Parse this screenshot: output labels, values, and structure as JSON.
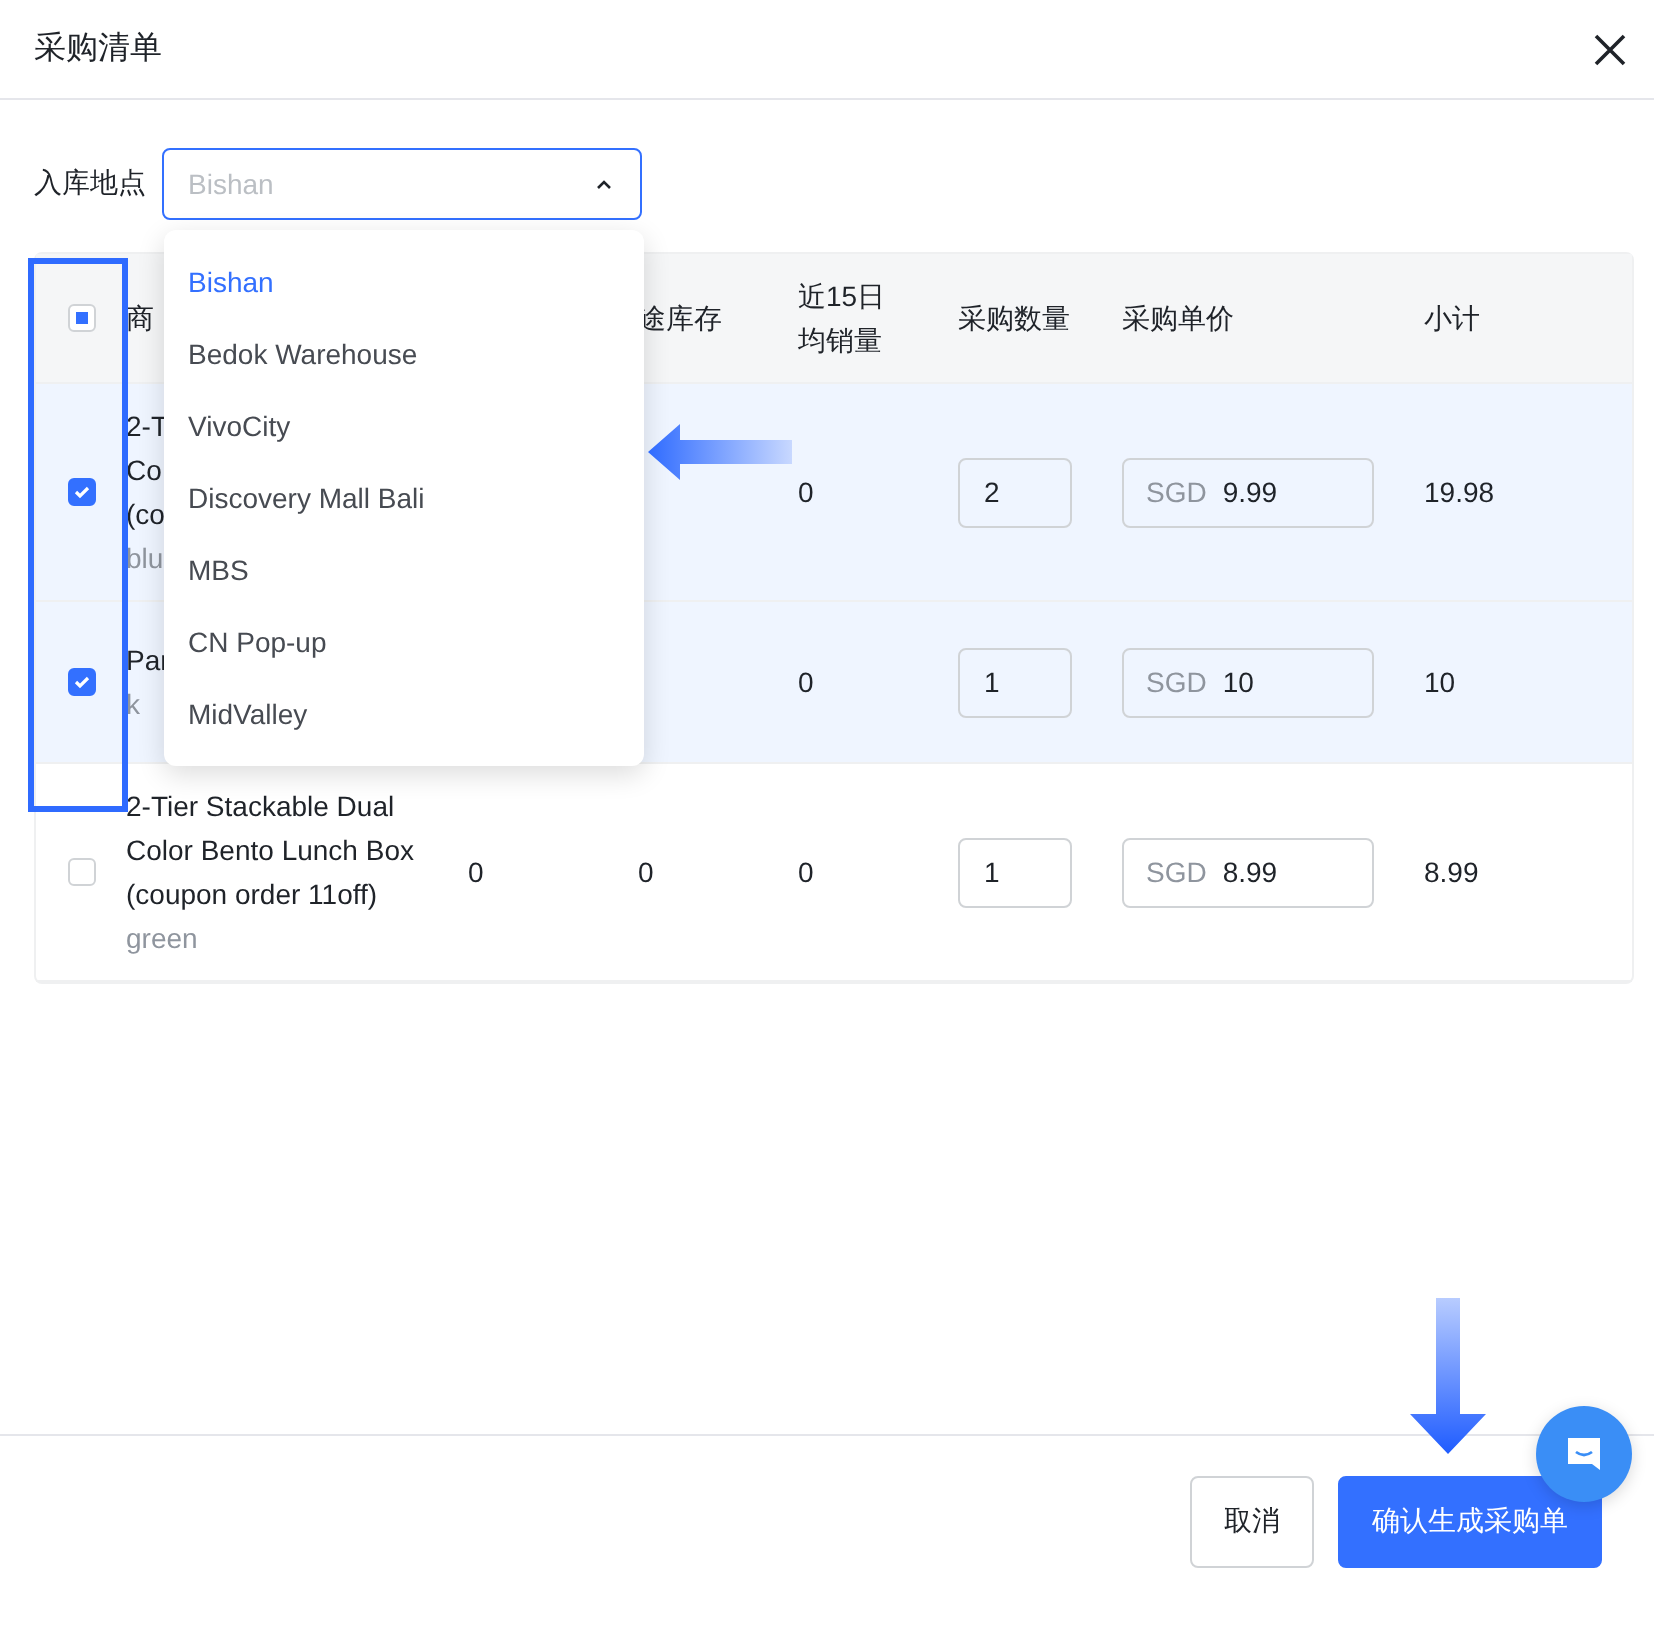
{
  "dialog": {
    "title": "采购清单"
  },
  "location": {
    "label": "入库地点",
    "placeholder": "Bishan",
    "expanded": true,
    "options": [
      {
        "label": "Bishan",
        "selected": true
      },
      {
        "label": "Bedok Warehouse",
        "selected": false
      },
      {
        "label": "VivoCity",
        "selected": false
      },
      {
        "label": "Discovery Mall Bali",
        "selected": false
      },
      {
        "label": "MBS",
        "selected": false
      },
      {
        "label": "CN Pop-up",
        "selected": false
      },
      {
        "label": "MidValley",
        "selected": false
      }
    ]
  },
  "table": {
    "select_all": {
      "indeterminate": true
    },
    "columns": [
      "商",
      "",
      "途库存",
      "近15日均销量",
      "采购数量",
      "采购单价",
      "小计"
    ],
    "rows": [
      {
        "checked": true,
        "name": "2-T\nCo\n(co",
        "variant": "blu",
        "column_2": "",
        "column_3": "",
        "avg_sales": "0",
        "quantity": "2",
        "currency": "SGD",
        "unit_price": "9.99",
        "subtotal": "19.98"
      },
      {
        "checked": true,
        "name": "Par",
        "variant": "k",
        "column_2": "",
        "column_3": "",
        "avg_sales": "0",
        "quantity": "1",
        "currency": "SGD",
        "unit_price": "10",
        "subtotal": "10"
      },
      {
        "checked": false,
        "name": "2-Tier Stackable Dual\nColor Bento Lunch Box\n(coupon order 11off)",
        "variant": "green",
        "column_2": "0",
        "column_3": "0",
        "avg_sales": "0",
        "quantity": "1",
        "currency": "SGD",
        "unit_price": "8.99",
        "subtotal": "8.99"
      }
    ]
  },
  "footer": {
    "buttons": [
      {
        "label": "取消",
        "kind": "secondary"
      },
      {
        "label": "确认生成采购单",
        "kind": "primary"
      }
    ]
  }
}
